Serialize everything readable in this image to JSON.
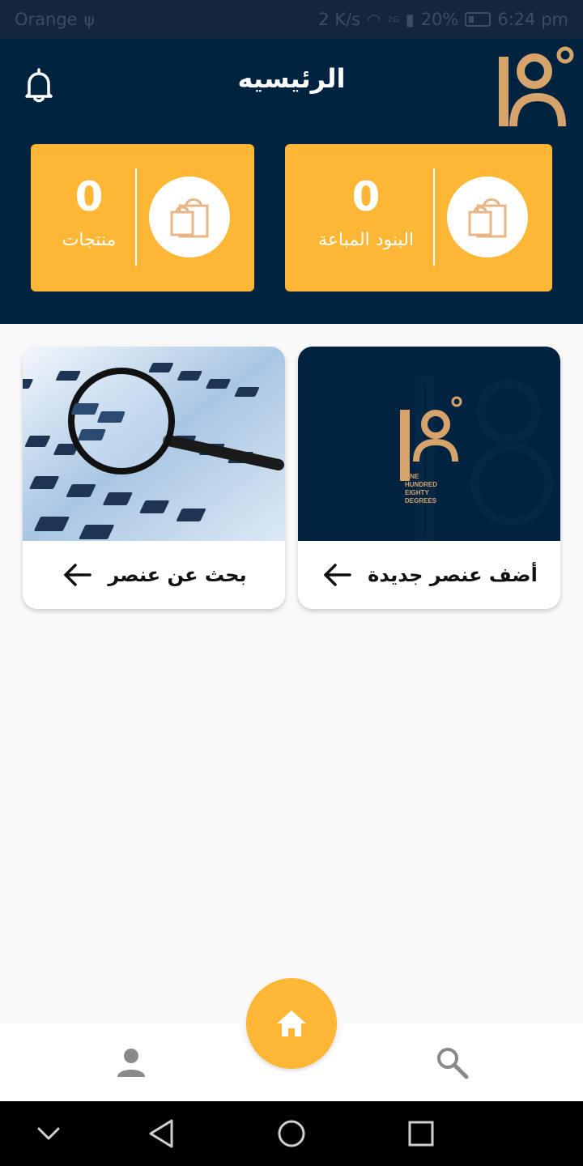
{
  "status_bar": {
    "carrier": "Orange",
    "speed": "2 K/s",
    "network": "2G",
    "battery": "20%",
    "time": "6:24 pm"
  },
  "header": {
    "title": "الرئيسيه",
    "logo_text": "18°",
    "icons": {
      "notifications": "bell-icon"
    }
  },
  "stats": [
    {
      "value": "0",
      "label": "البنود المباعة",
      "icon": "shopping-bags-icon"
    },
    {
      "value": "0",
      "label": "منتجات",
      "icon": "shopping-bags-icon"
    }
  ],
  "tiles": [
    {
      "label": "أضف عنصر جديدة",
      "image": {
        "logo_text": "18°",
        "lines": [
          "ONE",
          "HUNDRED",
          "EIGHTY",
          "DEGREES"
        ]
      }
    },
    {
      "label": "بحث عن عنصر",
      "image": "magnifier-keyboard-photo"
    }
  ],
  "bottom_nav": {
    "items": [
      "user-icon",
      "home-icon",
      "search-icon"
    ],
    "active": "home"
  },
  "colors": {
    "primary": "#002340",
    "accent": "#fdb734",
    "logo_gold": "#d6a36a",
    "background": "#f9f9f9"
  }
}
